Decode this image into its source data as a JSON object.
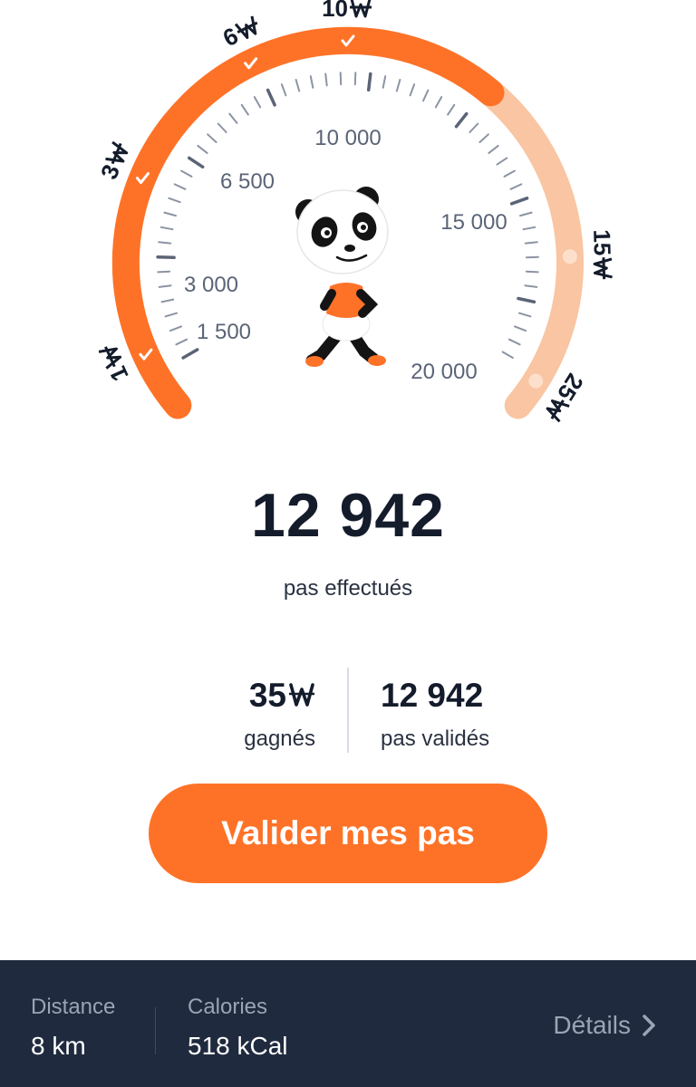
{
  "gauge": {
    "milestones": [
      {
        "label": "1",
        "reached": true
      },
      {
        "label": "3",
        "reached": true
      },
      {
        "label": "6",
        "reached": true
      },
      {
        "label": "10",
        "reached": true
      },
      {
        "label": "15",
        "reached": false
      },
      {
        "label": "25",
        "reached": false
      }
    ],
    "scale_labels": [
      "1 500",
      "3 000",
      "6 500",
      "10 000",
      "15 000",
      "20 000"
    ],
    "progress_steps": 12942,
    "accent_color": "#fe7228",
    "pending_color": "#f9c5a2",
    "currency_icon": "won-sign-icon",
    "mascot": "panda-walking-mascot"
  },
  "steps": {
    "count": "12 942",
    "caption": "pas effectués"
  },
  "stats": {
    "earned_value": "35",
    "earned_label": "gagnés",
    "validated_value": "12 942",
    "validated_label": "pas validés"
  },
  "actions": {
    "validate_label": "Valider mes pas"
  },
  "footer": {
    "distance_label": "Distance",
    "distance_value": "8 km",
    "calories_label": "Calories",
    "calories_value": "518 kCal",
    "details_label": "Détails"
  },
  "colors": {
    "footer_bg": "#1f2a3e",
    "text_dark": "#141c2c"
  }
}
